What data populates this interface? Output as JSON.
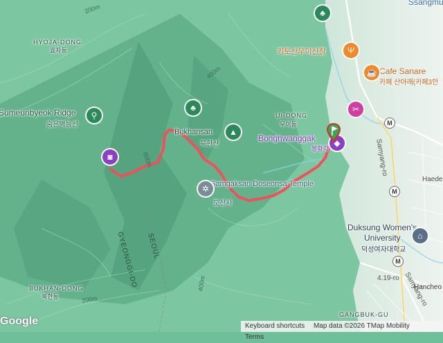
{
  "places": {
    "ssangmun": "Ssangmun",
    "hyoja_en": "HYOJA-DONG",
    "hyoja_ko": "효자동",
    "sumeun_en": "Sumeunbyeok Ridge",
    "sumeun_ko": "숨은벽능선",
    "bukhansan_en": "Bukhansan",
    "bukhansan_ko": "북한산",
    "ui_en": "UI-DONG",
    "ui_ko": "우이동",
    "bonghwang_en": "Bonghwanggak",
    "bonghwang_ko": "봉황각",
    "samgak_en": "Samgaksan Doseonsa Temple",
    "samgak_ko": "도선사",
    "kitosan_ko": "키토산우이산장",
    "cafe_en": "Cafe Sanare",
    "cafe_ko": "카페 산아래(카페3안",
    "samyang": "Samyang-ro",
    "haedeung": "Haedeu",
    "duksung_en1": "Duksung Women's",
    "duksung_en2": "University",
    "duksung_ko": "덕성여자대학교",
    "seoul": "SEOUL",
    "gyeonggi": "GYEONGGI-DO",
    "bukhan_en": "BUKHAN-DONG",
    "bukhan_ko": "북한동",
    "road419": "4.19-ro",
    "samyang2": "Samyang-ro",
    "hancheon": "Hancheo",
    "gangbuk": "GANGBUK-GU"
  },
  "contours": {
    "c200": "200m",
    "c400": "400m",
    "c600": "600m"
  },
  "markers": {
    "metro": "M"
  },
  "footer": {
    "google": "Google",
    "keyboard": "Keyboard shortcuts",
    "attribution": "Map data ©2026 TMap Mobility",
    "terms": "Terms"
  },
  "colors": {
    "route": "#f0505a",
    "terrain": "#6fbf9a",
    "poi_park": "#2a8a5a",
    "poi_purple": "#8a3fc4",
    "poi_food": "#f08a28"
  }
}
